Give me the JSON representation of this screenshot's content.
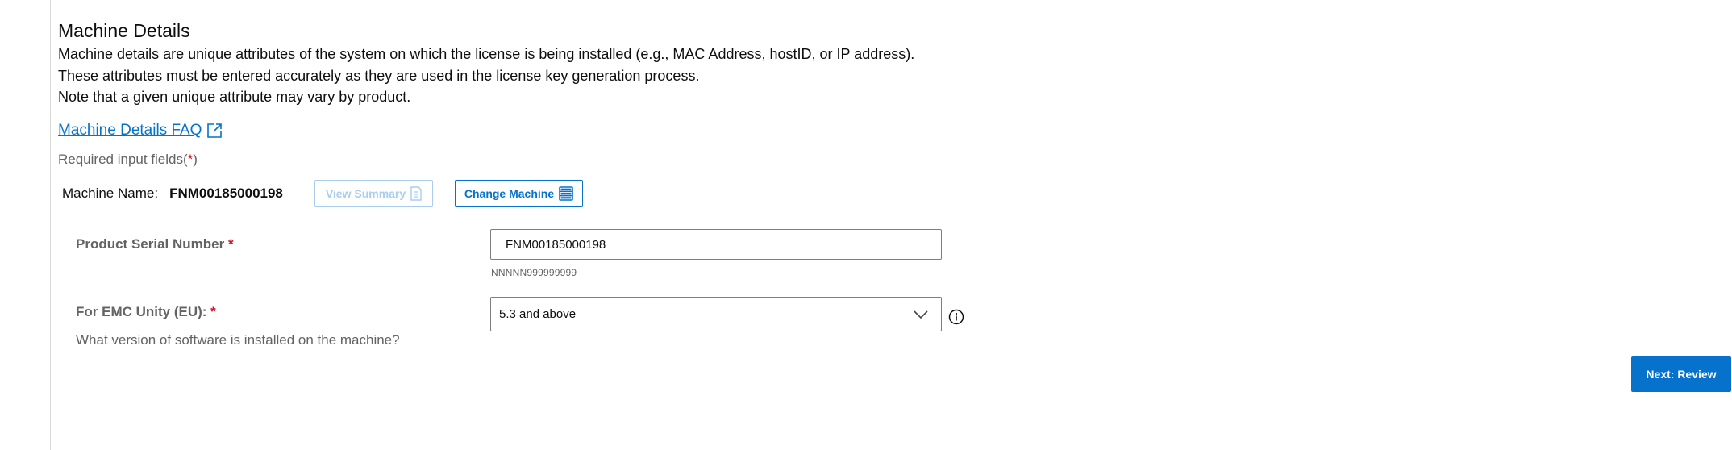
{
  "section": {
    "title": "Machine Details",
    "description_lines": [
      "Machine details are unique attributes of the system on which the license is being installed (e.g., MAC Address, hostID, or IP address).",
      "These attributes must be entered accurately as they are used in the license key generation process.",
      "Note that a given unique attribute may vary by product."
    ],
    "faq_link": "Machine Details FAQ",
    "required_note": "Required input fields(",
    "required_star": "*",
    "required_close": ")"
  },
  "machine": {
    "label": "Machine Name:",
    "value": "FNM00185000198",
    "view_summary_label": "View Summary",
    "change_machine_label": "Change Machine"
  },
  "form": {
    "serial": {
      "label": "Product Serial Number",
      "required_star": "*",
      "value": "FNM00185000198",
      "hint": "NNNNN999999999"
    },
    "version": {
      "label": "For EMC Unity (EU):",
      "required_star": "*",
      "selected": "5.3 and above",
      "question": "What version of software is installed on the machine?"
    }
  },
  "actions": {
    "next_label": "Next: Review"
  },
  "colors": {
    "accent": "#0672cb",
    "accent_disabled": "#a8cdee",
    "required": "#ce1126",
    "muted_text": "#636363"
  },
  "icons": {
    "faq": "external-link-icon",
    "view_summary": "document-icon",
    "change_machine": "server-rack-icon",
    "dropdown": "chevron-down-icon",
    "info": "info-icon"
  }
}
